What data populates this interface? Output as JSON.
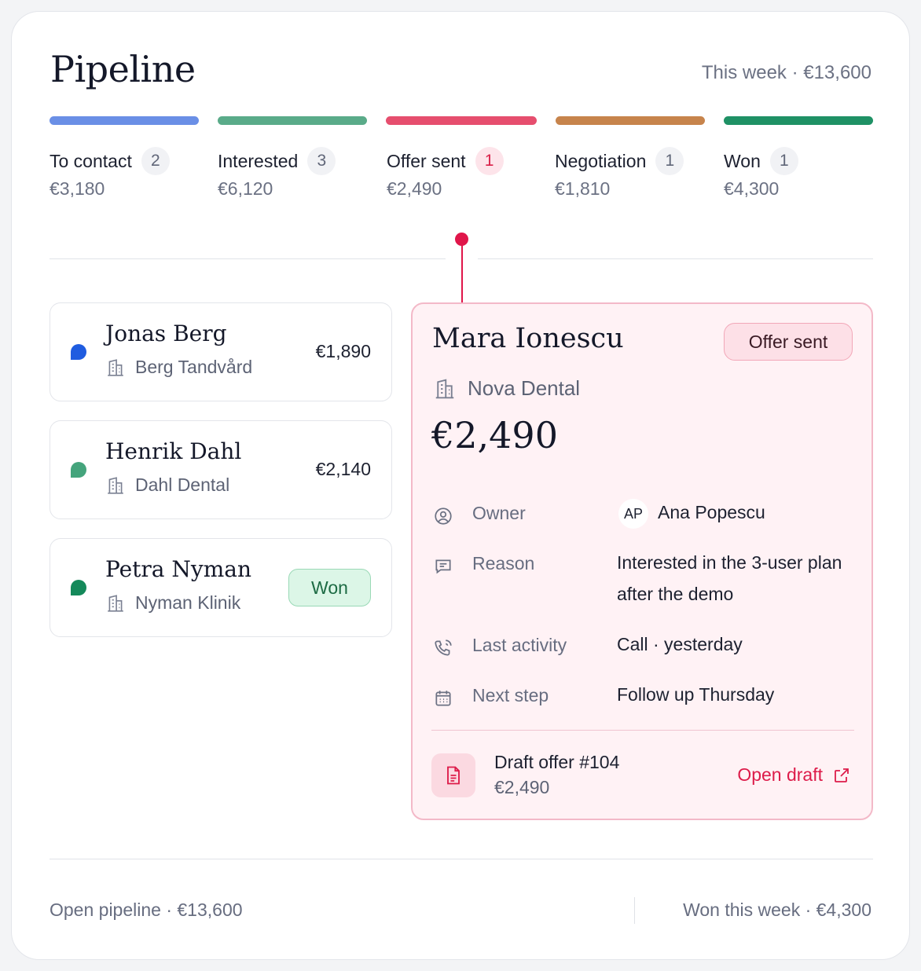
{
  "header": {
    "title": "Pipeline",
    "week_summary": "This week · €13,600"
  },
  "stages": [
    {
      "name": "To contact",
      "count": "2",
      "amount": "€3,180",
      "color": "#6a8fe6"
    },
    {
      "name": "Interested",
      "count": "3",
      "amount": "€6,120",
      "color": "#5aab89"
    },
    {
      "name": "Offer sent",
      "count": "1",
      "amount": "€2,490",
      "color": "#e64e6e"
    },
    {
      "name": "Negotiation",
      "count": "1",
      "amount": "€1,810",
      "color": "#c7844c"
    },
    {
      "name": "Won",
      "count": "1",
      "amount": "€4,300",
      "color": "#1f9165"
    }
  ],
  "deals": [
    {
      "name": "Jonas Berg",
      "company": "Berg Tandvård",
      "amount": "€1,890",
      "dot_color": "#1f5ce0"
    },
    {
      "name": "Henrik Dahl",
      "company": "Dahl Dental",
      "amount": "€2,140",
      "dot_color": "#44a47c"
    },
    {
      "name": "Petra Nyman",
      "company": "Nyman Klinik",
      "badge": "Won",
      "dot_color": "#14895a"
    }
  ],
  "detail": {
    "name": "Mara Ionescu",
    "stage_badge": "Offer sent",
    "company": "Nova Dental",
    "amount": "€2,490",
    "owner_label": "Owner",
    "owner_initials": "AP",
    "owner_name": "Ana Popescu",
    "reason_label": "Reason",
    "reason_value": "Interested in the 3-user plan after the demo",
    "activity_label": "Last activity",
    "activity_value": "Call · yesterday",
    "next_label": "Next step",
    "next_value": "Follow up Thursday",
    "draft_title": "Draft offer #104",
    "draft_amount": "€2,490",
    "open_draft": "Open draft"
  },
  "footer": {
    "open_pipeline": "Open pipeline · €13,600",
    "won_week": "Won this week · €4,300"
  },
  "icons": {
    "company": "building-icon",
    "owner": "user-circle-icon",
    "reason": "message-icon",
    "activity": "phone-icon",
    "next": "calendar-icon",
    "doc": "document-icon",
    "external": "external-link-icon"
  },
  "colors": {
    "accent": "#e0164a",
    "won_bg": "#dcf6e7",
    "detail_bg": "#fff2f5"
  }
}
